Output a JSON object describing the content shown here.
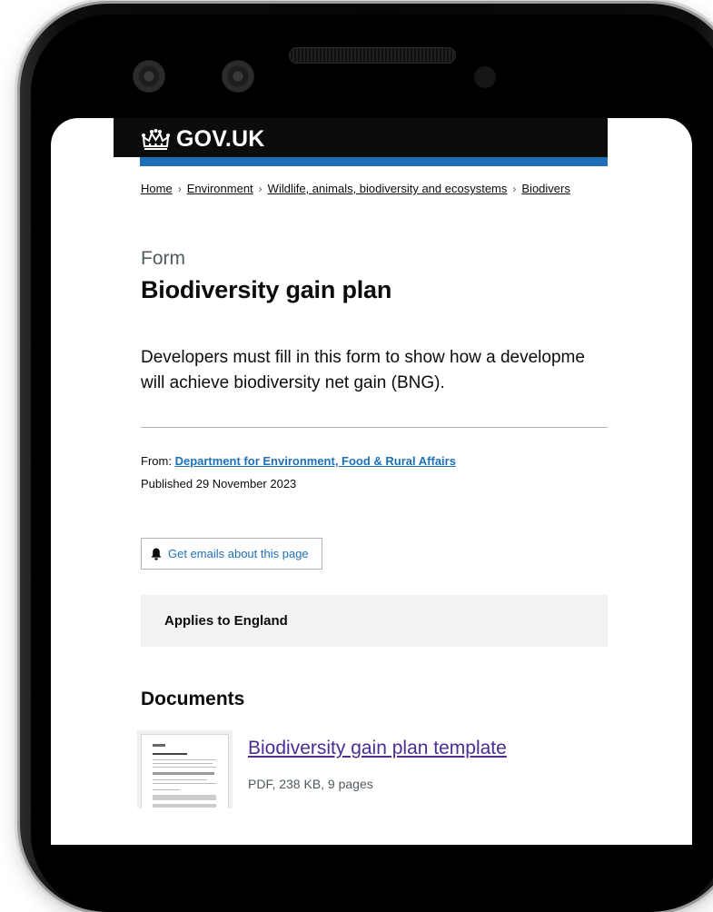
{
  "header": {
    "logo_text": "GOV.UK",
    "logo_icon": "crown-icon"
  },
  "breadcrumb": {
    "items": [
      "Home",
      "Environment",
      "Wildlife, animals, biodiversity and ecosystems",
      "Biodivers"
    ]
  },
  "page": {
    "caption": "Form",
    "title": "Biodiversity gain plan",
    "lead_line1": "Developers must fill in this form to show how a developme",
    "lead_line2": "will achieve biodiversity net gain (BNG)."
  },
  "meta": {
    "from_label": "From:",
    "from_org": "Department for Environment, Food & Rural Affairs",
    "published": "Published 29 November 2023"
  },
  "actions": {
    "email_label": "Get emails about this page",
    "email_icon": "bell-icon"
  },
  "applies": {
    "label": "Applies to England"
  },
  "documents": {
    "heading": "Documents",
    "items": [
      {
        "title": "Biodiversity gain plan template",
        "meta": "PDF, 238 KB, 9 pages"
      }
    ]
  },
  "colors": {
    "header_bg": "#0b0c0c",
    "header_bar": "#1d70b8",
    "link": "#1d70b8",
    "visited_link": "#4c2c92",
    "inset_bg": "#f3f2f1"
  }
}
